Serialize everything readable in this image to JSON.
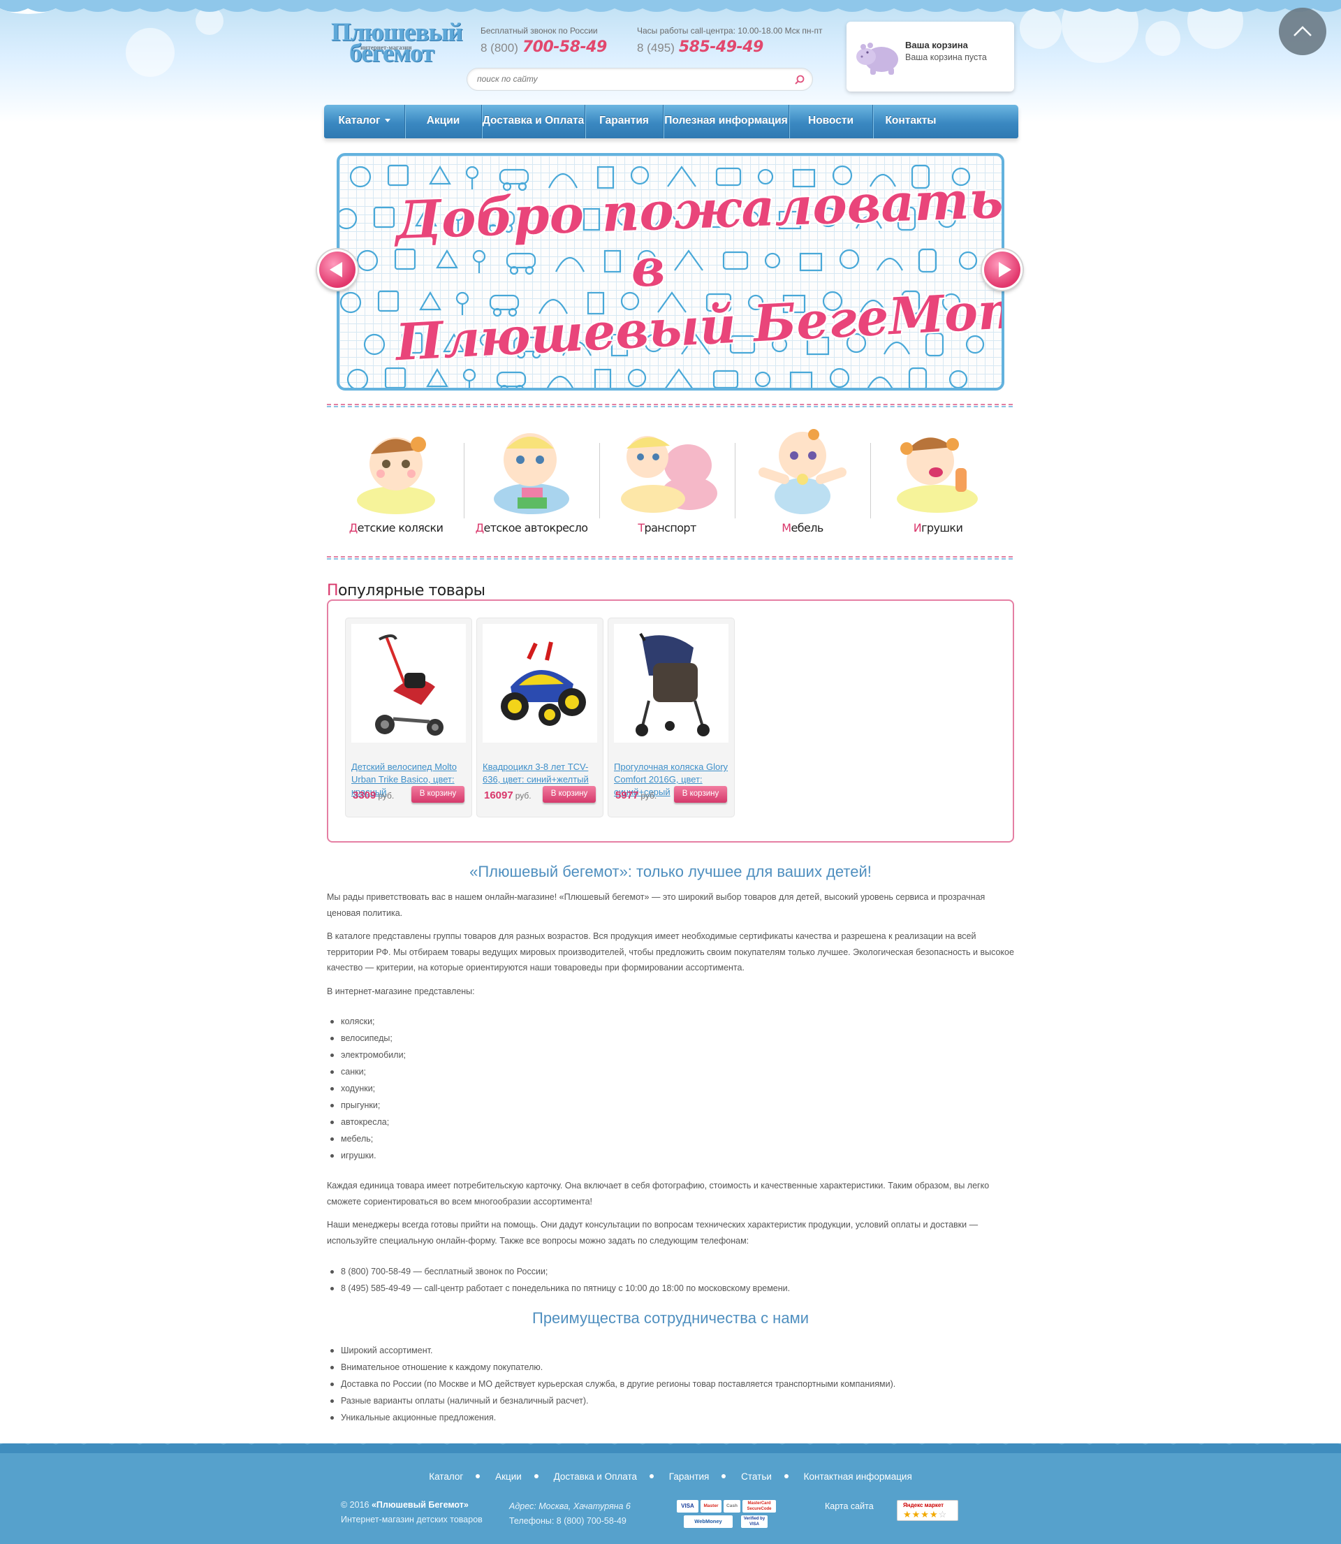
{
  "header": {
    "logo": {
      "line1": "Плюшевый",
      "line2": "интернет-магазин",
      "line3": "бегемот"
    },
    "phone1": {
      "caption": "Бесплатный звонок по России",
      "code": "8 (800)",
      "number": "700-58-49"
    },
    "phone2": {
      "caption": "Часы работы call-центра: 10.00-18.00 Мск пн-пт",
      "code": "8 (495)",
      "number": "585-49-49"
    },
    "search": {
      "placeholder": "поиск по сайту"
    },
    "cart": {
      "title": "Ваша корзина",
      "status": "Ваша корзина пуста"
    }
  },
  "nav": {
    "items": [
      {
        "label": "Каталог",
        "dropdown": true
      },
      {
        "label": "Акции"
      },
      {
        "label": "Доставка и Оплата"
      },
      {
        "label": "Гарантия"
      },
      {
        "label": "Полезная информация"
      },
      {
        "label": "Новости"
      },
      {
        "label": "Контакты"
      }
    ]
  },
  "banner": {
    "line1": "Добро пожаловать",
    "line2": "в",
    "line3": "Плюшевый БегеМот!!!"
  },
  "categories": [
    {
      "first": "Д",
      "rest": "етские коляски"
    },
    {
      "first": "Д",
      "rest": "етское автокресло"
    },
    {
      "first": "Т",
      "rest": "ранспорт"
    },
    {
      "first": "М",
      "rest": "ебель"
    },
    {
      "first": "И",
      "rest": "грушки"
    }
  ],
  "popular": {
    "title_first": "П",
    "title_rest": "опулярные товары",
    "products": [
      {
        "name": "Детский велосипед Molto Urban Trike Basico, цвет: красный",
        "price": "3309",
        "currency": "руб.",
        "button": "В корзину"
      },
      {
        "name": "Квадроцикл 3-8 лет TCV-636, цвет: синий+желтый",
        "price": "16097",
        "currency": "руб.",
        "button": "В корзину"
      },
      {
        "name": "Прогулочная коляска Glory Comfort 2016G, цвет: синий+серый",
        "price": "5977",
        "currency": "руб.",
        "button": "В корзину"
      }
    ]
  },
  "article": {
    "title": "«Плюшевый бегемот»: только лучшее для ваших детей!",
    "p1": "Мы рады приветствовать вас в нашем онлайн-магазине! «Плюшевый бегемот» — это широкий выбор товаров для детей, высокий уровень сервиса и прозрачная ценовая политика.",
    "p2": "В каталоге представлены группы товаров для разных возрастов. Вся продукция имеет необходимые сертификаты качества и разрешена к реализации на всей территории РФ. Мы отбираем товары ведущих мировых производителей, чтобы предложить своим покупателям только лучшее. Экологическая безопасность и высокое качество — критерии, на которые ориентируются наши товароведы при формировании ассортимента.",
    "p3": "В интернет-магазине представлены:",
    "list1": [
      "коляски;",
      "велосипеды;",
      "электромобили;",
      "санки;",
      "ходунки;",
      "прыгунки;",
      "автокресла;",
      "мебель;",
      "игрушки."
    ],
    "p4": "Каждая единица товара имеет потребительскую карточку. Она включает в себя фотографию, стоимость и качественные характеристики. Таким образом, вы легко сможете сориентироваться во всем многообразии ассортимента!",
    "p5": "Наши менеджеры всегда готовы прийти на помощь. Они дадут консультации по вопросам технических характеристик продукции, условий оплаты и доставки — используйте специальную онлайн-форму. Также все вопросы можно задать по следующим телефонам:",
    "list2": [
      "8 (800) 700-58-49 — бесплатный звонок по России;",
      "8 (495) 585-49-49 — call-центр работает с понедельника по пятницу с 10:00 до 18:00 по московскому времени."
    ],
    "title2": "Преимущества сотрудничества с нами",
    "list3": [
      "Широкий ассортимент.",
      "Внимательное отношение к каждому покупателю.",
      "Доставка по России (по Москве и МО действует курьерская служба, в другие регионы товар поставляется транспортными компаниями).",
      "Разные варианты оплаты (наличный и безналичный расчет).",
      "Уникальные акционные предложения."
    ]
  },
  "footer": {
    "nav": [
      "Каталог",
      "Акции",
      "Доставка и Оплата",
      "Гарантия",
      "Статьи",
      "Контактная информация"
    ],
    "copyright_year": "© 2016",
    "copyright_name": "«Плюшевый Бегемот»",
    "tagline": "Интернет-магазин детских товаров",
    "address": "Адрес: Москва, Хачатуряна 6",
    "phones": "Телефоны: 8 (800) 700-58-49",
    "sitemap": "Карта сайта",
    "payments": [
      "VISA",
      "Master",
      "Cash",
      "MasterCard SecureCode",
      "WebMoney",
      "Verified by VISA"
    ],
    "market": "Яндекс маркет",
    "market_stars": 4
  },
  "colors": {
    "accent_pink": "#d9376b",
    "nav_blue": "#3a88c1",
    "footer_blue": "#56a1cc",
    "link_blue": "#3e8fc9"
  }
}
